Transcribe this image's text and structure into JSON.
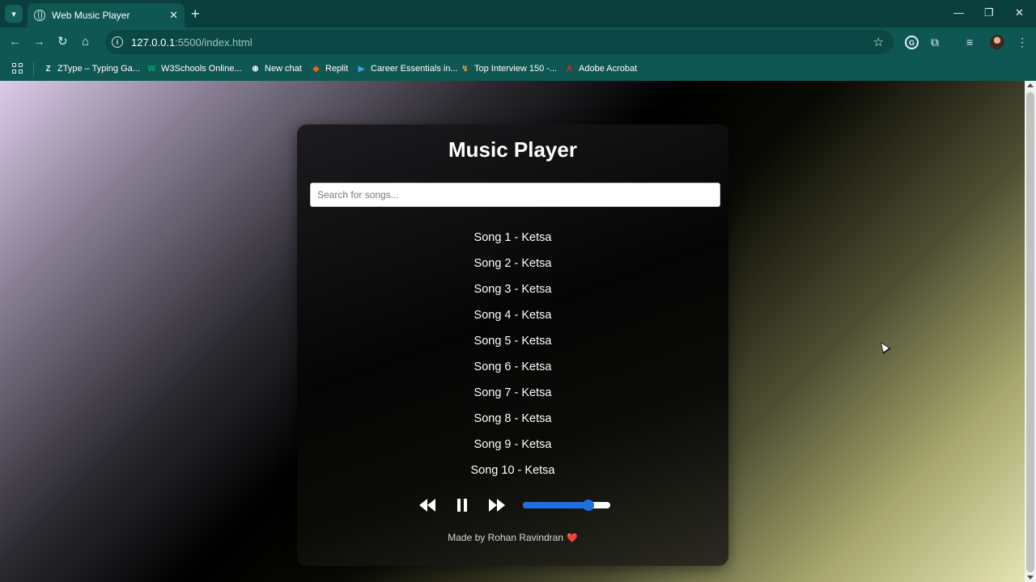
{
  "browser": {
    "tab": {
      "title": "Web Music Player",
      "close_glyph": "✕"
    },
    "new_tab_glyph": "+",
    "window": {
      "minimize": "—",
      "restore": "❐",
      "close": "✕"
    },
    "url": {
      "host": "127.0.0.1",
      "path": ":5500/index.html"
    },
    "bookmarks": [
      {
        "label": "ZType – Typing Ga...",
        "icon": "ztype-icon",
        "icon_glyph": "Z",
        "color": "#e6f2f1"
      },
      {
        "label": "W3Schools Online...",
        "icon": "w3schools-icon",
        "icon_glyph": "W",
        "color": "#04aa6d"
      },
      {
        "label": "New chat",
        "icon": "chatgpt-icon",
        "icon_glyph": "⊛",
        "color": "#ffffff"
      },
      {
        "label": "Replit",
        "icon": "replit-icon",
        "icon_glyph": "◆",
        "color": "#f26207"
      },
      {
        "label": "Career Essentials in...",
        "icon": "linkedin-learning-icon",
        "icon_glyph": "▶",
        "color": "#3aa0e0"
      },
      {
        "label": "Top Interview 150 -...",
        "icon": "leetcode-icon",
        "icon_glyph": "↯",
        "color": "#ffa116"
      },
      {
        "label": "Adobe Acrobat",
        "icon": "adobe-acrobat-icon",
        "icon_glyph": "A",
        "color": "#e3241b"
      }
    ]
  },
  "page": {
    "title": "Music Player",
    "search": {
      "placeholder": "Search for songs...",
      "value": ""
    },
    "songs": [
      "Song 1 - Ketsa",
      "Song 2 - Ketsa",
      "Song 3 - Ketsa",
      "Song 4 - Ketsa",
      "Song 5 - Ketsa",
      "Song 6 - Ketsa",
      "Song 7 - Ketsa",
      "Song 8 - Ketsa",
      "Song 9 - Ketsa",
      "Song 10 - Ketsa"
    ],
    "player": {
      "state": "playing",
      "volume": 0.75
    },
    "footer": {
      "text": "Made by Rohan Ravindran",
      "heart": "❤️"
    },
    "colors": {
      "accent": "#1f6fe0",
      "heart": "#e63946"
    }
  }
}
